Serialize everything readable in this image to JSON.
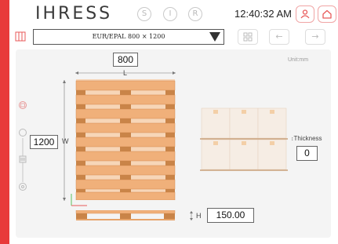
{
  "header": {
    "logo": "IHRESS",
    "modes": [
      "S",
      "I",
      "R"
    ],
    "clock": "12:40:32 AM",
    "user_icon": "user-icon",
    "home_icon": "home-icon"
  },
  "toolbar": {
    "pallet_select_value": "EUR/EPAL 800 × 1200",
    "grid_icon": "grid-icon",
    "back_icon": "arrow-left-icon",
    "forward_icon": "arrow-right-icon",
    "back_label": "←",
    "forward_label": "→"
  },
  "canvas": {
    "unit_label": "Unit:mm",
    "length_value": "800",
    "length_axis": "L",
    "width_value": "1200",
    "width_axis": "W",
    "height_axis": "H",
    "height_value": "150.00",
    "thickness_label": "Thickness",
    "thickness_value": "0"
  },
  "colors": {
    "accent": "#e83a3a",
    "pallet_board": "#f0b07a",
    "pallet_dark": "#d48a4e"
  }
}
